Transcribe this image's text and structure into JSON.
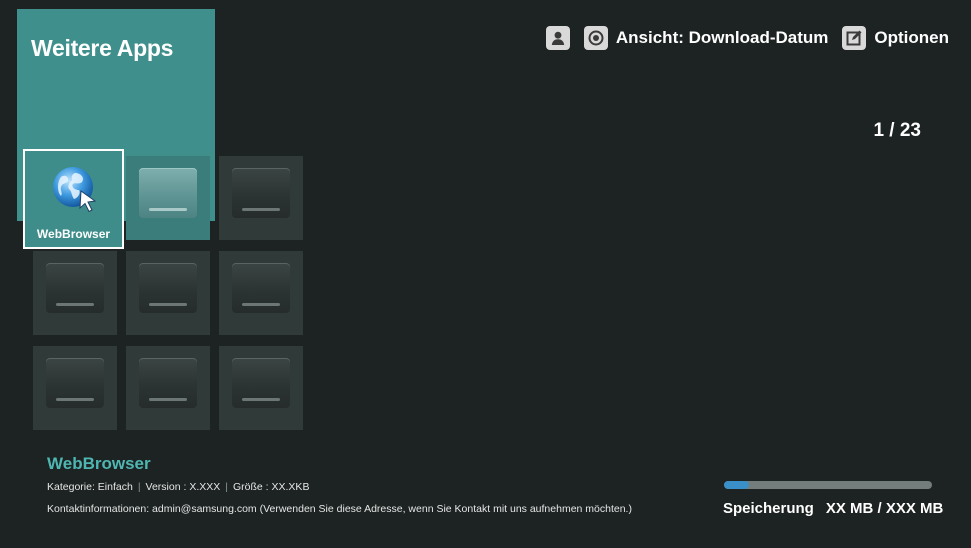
{
  "header": {
    "title": "Weitere Apps"
  },
  "topbar": {
    "profile_icon": "person-icon",
    "view_icon": "view-icon",
    "view_label": "Ansicht: Download-Datum",
    "options_icon": "edit-icon",
    "options_label": "Optionen"
  },
  "pagination": {
    "counter": "1 / 23"
  },
  "apps": {
    "selected": {
      "label": "WebBrowser",
      "icon": "globe-cursor-icon"
    }
  },
  "details": {
    "name": "WebBrowser",
    "category": "Kategorie: Einfach",
    "version": "Version : X.XXX",
    "size": "Größe : XX.XKB",
    "contact": "Kontaktinformationen: admin@samsung.com (Verwenden Sie diese Adresse, wenn Sie Kontakt mit uns aufnehmen möchten.)"
  },
  "storage": {
    "label": "Speicherung",
    "value": "XX MB / XXX  MB",
    "used_fraction": 0.12
  },
  "colors": {
    "accent": "#3f8f8c",
    "app_name": "#4fb7b2",
    "background": "#1c2322",
    "storage_fill": "#3a8fc8"
  }
}
